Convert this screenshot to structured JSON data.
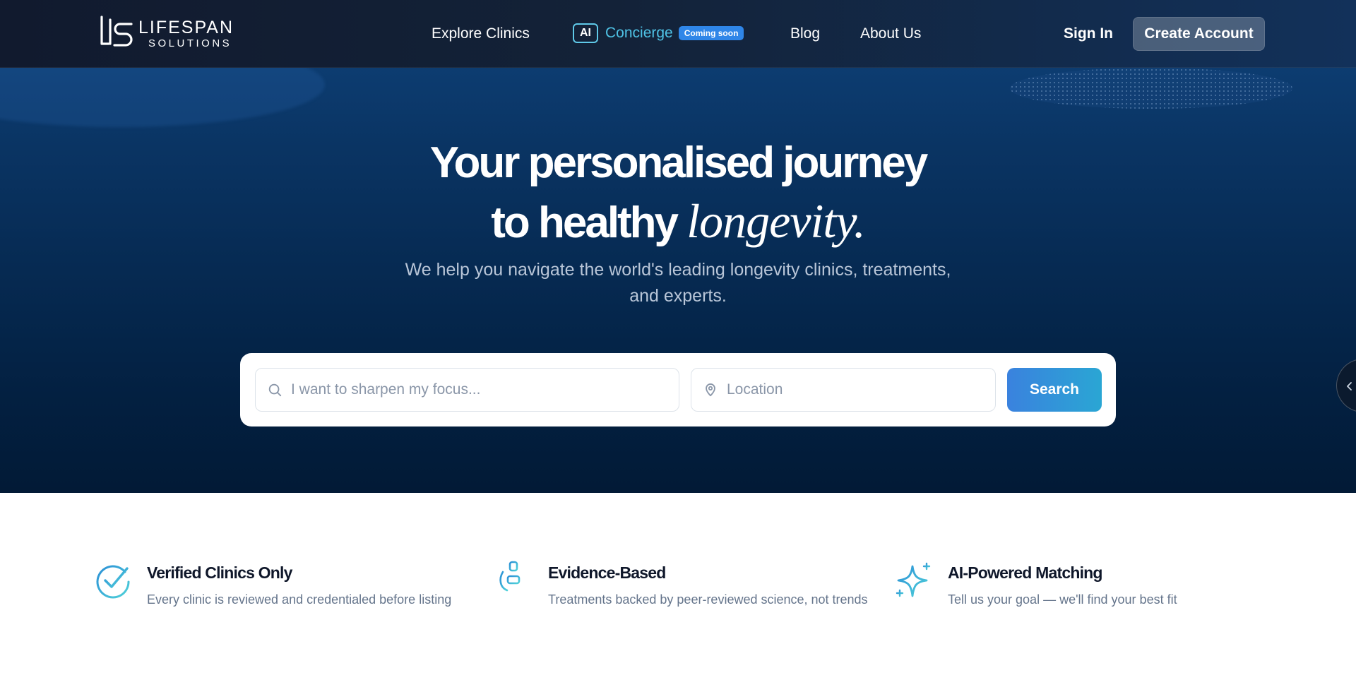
{
  "brand": {
    "line1": "LIFESPAN",
    "line2": "SOLUTIONS"
  },
  "nav": {
    "explore": "Explore Clinics",
    "ai_chip": "AI",
    "concierge": "Concierge",
    "coming_soon": "Coming soon",
    "blog": "Blog",
    "about": "About Us",
    "sign_in": "Sign In",
    "create_account": "Create Account"
  },
  "hero": {
    "headline_line1": "Your personalised journey",
    "headline_line2_plain": "to healthy",
    "headline_line2_italic": "longevity.",
    "subhead": "We help you navigate the world's leading longevity clinics, treatments, and experts."
  },
  "search": {
    "focus_placeholder": "I want to sharpen my focus...",
    "location_placeholder": "Location",
    "button": "Search"
  },
  "features": [
    {
      "title": "Verified Clinics Only",
      "desc": "Every clinic is reviewed and credentialed before listing",
      "icon": "verified-check-icon"
    },
    {
      "title": "Evidence-Based",
      "desc": "Treatments backed by peer-reviewed science, not trends",
      "icon": "microscope-icon"
    },
    {
      "title": "AI-Powered Matching",
      "desc": "Tell us your goal — we'll find your best fit",
      "icon": "sparkle-icon"
    }
  ],
  "colors": {
    "accent_cyan": "#4fc3e6",
    "badge_blue": "#2f86e8",
    "hero_navy": "#062a52",
    "button_gradient_start": "#3a82de",
    "button_gradient_end": "#2aa6d4"
  }
}
